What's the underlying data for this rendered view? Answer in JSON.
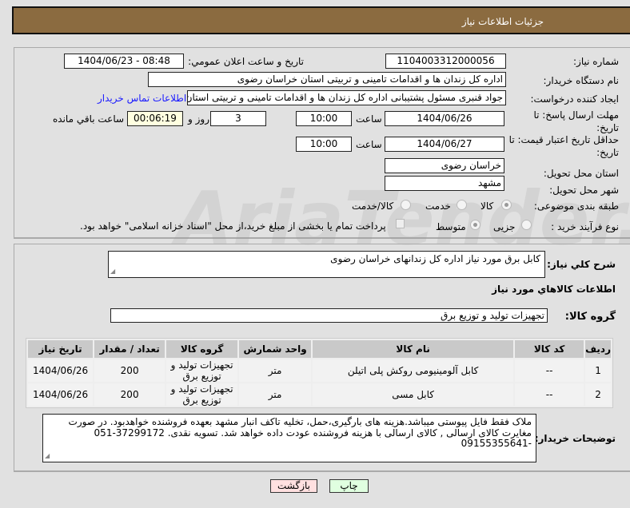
{
  "header": {
    "title": "جزئیات اطلاعات نیاز"
  },
  "watermark": "AriaTender.net",
  "form": {
    "need_number_label": "شماره نیاز:",
    "need_number": "1104003312000056",
    "announce_label": "تاریخ و ساعت اعلان عمومي:",
    "announce_value": "1404/06/23 - 08:48",
    "buyer_org_label": "نام دستگاه خریدار:",
    "buyer_org": "اداره کل زندان ها و اقدامات تامینی و تربیتی استان خراسان رضوی",
    "creator_label": "ایجاد کننده درخواست:",
    "creator": "جواد قنبری مسئول پشتیبانی اداره کل زندان ها و اقدامات تامینی و تربیتی استان",
    "contact_link": "اطلاعات تماس خریدار",
    "deadline_label": "مهلت ارسال پاسخ: تا تاریخ:",
    "deadline_date": "1404/06/26",
    "time_label": "ساعت",
    "deadline_time": "10:00",
    "days": "3",
    "days_label": "روز و",
    "remaining": "00:06:19",
    "remaining_label": "ساعت باقي مانده",
    "validity_label": "حداقل تاریخ اعتبار قیمت: تا تاریخ:",
    "validity_date": "1404/06/27",
    "validity_time": "10:00",
    "province_label": "استان محل تحویل:",
    "province": "خراسان رضوی",
    "city_label": "شهر محل تحویل:",
    "city": "مشهد",
    "category_label": "طبقه بندی موضوعی:",
    "category_options": [
      "کالا",
      "خدمت",
      "کالا/خدمت"
    ],
    "category_selected": "کالا",
    "process_label": "نوع فرآیند خرید :",
    "process_options": [
      "جزیی",
      "متوسط"
    ],
    "payment_note": "پرداخت تمام یا بخشی از مبلغ خرید،از محل \"اسناد خزانه اسلامی\" خواهد بود."
  },
  "details": {
    "summary_label": "شرح کلي نیاز:",
    "summary": "کابل برق مورد نیاز اداره کل زندانهای خراسان رضوی",
    "goods_title": "اطلاعات کالاهاي مورد نیاز",
    "group_label": "گروه کالا:",
    "group": "تجهیزات تولید و توزیع برق",
    "table": {
      "headers": [
        "ردیف",
        "کد کالا",
        "نام کالا",
        "واحد شمارش",
        "گروه کالا",
        "تعداد / مقدار",
        "تاریخ نیاز"
      ],
      "rows": [
        [
          "1",
          "--",
          "کابل آلومینیومی روکش پلی اتیلن",
          "متر",
          "تجهیزات تولید و توزیع برق",
          "200",
          "1404/06/26"
        ],
        [
          "2",
          "--",
          "کابل مسی",
          "متر",
          "تجهیزات تولید و توزیع برق",
          "200",
          "1404/06/26"
        ]
      ]
    },
    "buyer_notes_label": "توضیحات خریدار:",
    "buyer_notes": "ملاک فقط فایل پیوستی میباشد.هزینه های بارگیری،حمل، تخلیه تاکف انبار مشهد بعهده فروشنده خواهدبود. در صورت مغایرت کالای ارسالی , کالای ارسالی با هزینه فروشنده  عودت داده خواهد شد. تسویه نقدی. 37299172-051 -09155355641"
  },
  "buttons": {
    "print": "چاپ",
    "back": "بازگشت"
  }
}
